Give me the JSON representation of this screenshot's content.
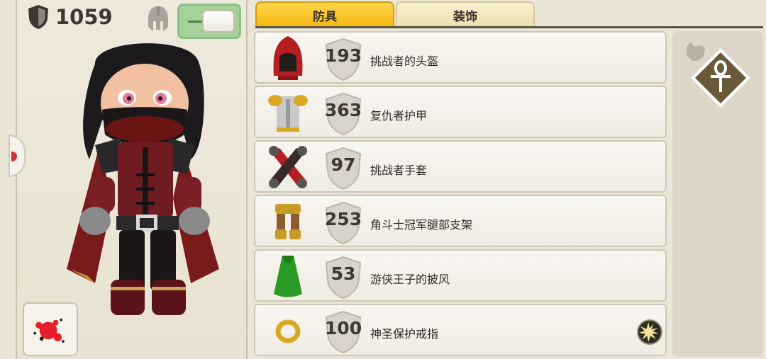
{
  "stats": {
    "armor_total": "1059"
  },
  "tabs": [
    {
      "label": "防具",
      "active": true
    },
    {
      "label": "装饰",
      "active": false
    }
  ],
  "items": [
    {
      "value": "193",
      "name": "挑战者的头盔",
      "icon": "red-hood-helmet-icon"
    },
    {
      "value": "363",
      "name": "复仇者护甲",
      "icon": "gold-chest-armor-icon"
    },
    {
      "value": "97",
      "name": "挑战者手套",
      "icon": "red-gloves-icon"
    },
    {
      "value": "253",
      "name": "角斗士冠军腿部支架",
      "icon": "gold-leg-armor-icon"
    },
    {
      "value": "53",
      "name": "游侠王子的披风",
      "icon": "green-cape-icon",
      "has_trait": false
    },
    {
      "value": "100",
      "name": "神圣保护戒指",
      "icon": "gold-ring-icon",
      "has_trait": true
    }
  ],
  "colors": {
    "tab_active": "#f4b711",
    "toggle_on": "#a5d29b",
    "ankh_frame": "#6b5a3a"
  }
}
